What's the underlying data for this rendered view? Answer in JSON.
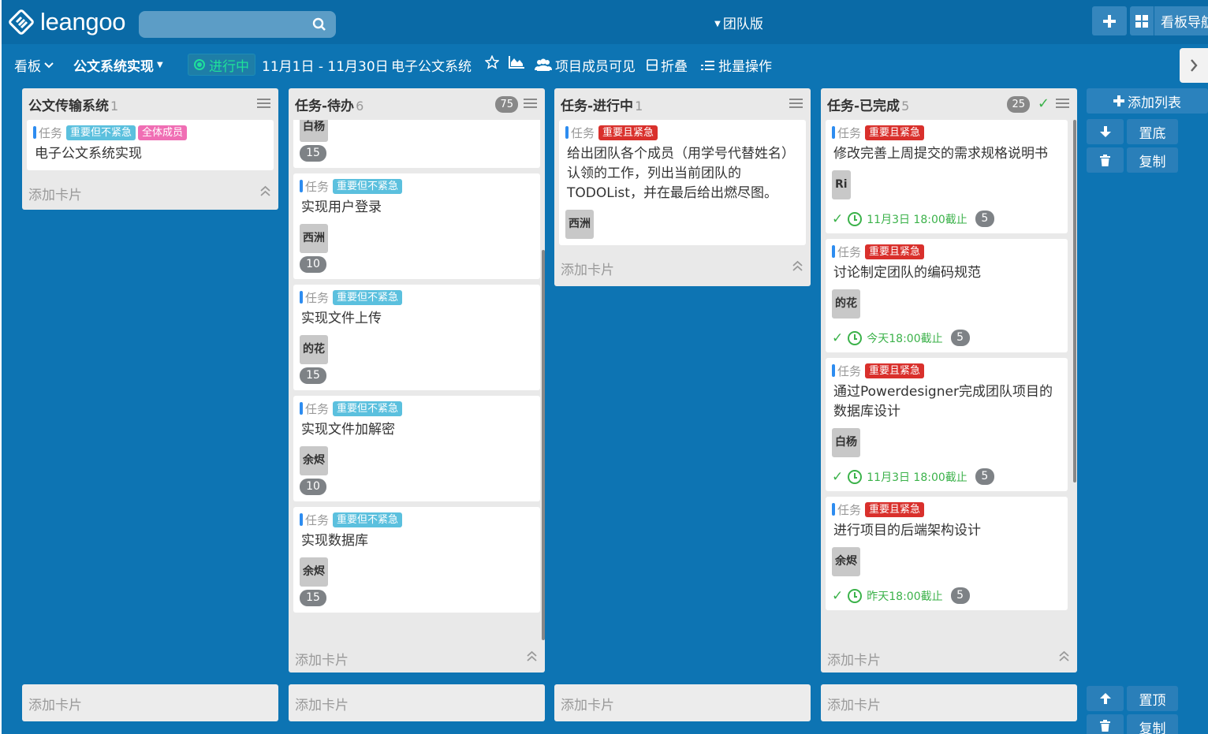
{
  "brand": "leangoo",
  "topbar": {
    "edition": "团队版",
    "board_nav_label": "看板导航"
  },
  "subbar": {
    "board_menu": "看板",
    "project_name": "公文系统实现",
    "status": "进行中",
    "date_range": "11月1日 - 11月30日",
    "project_label": "电子公文系统",
    "members_visible": "项目成员可见",
    "fold": "折叠",
    "batch": "批量操作"
  },
  "lists": [
    {
      "title": "公文传输系统",
      "count": "1",
      "cards": [
        {
          "type": "任务",
          "labels": [
            {
              "text": "重要但不紧急",
              "color": "#5bc0de"
            },
            {
              "text": "全体成员",
              "color": "#f06eb4"
            }
          ],
          "title": "电子公文系统实现"
        }
      ],
      "add_card": "添加卡片"
    },
    {
      "title": "任务-待办",
      "count": "6",
      "badge": "75",
      "cards": [
        {
          "assignee": "白杨",
          "points": "15"
        },
        {
          "type": "任务",
          "labels": [
            {
              "text": "重要但不紧急",
              "color": "#5bc0de"
            }
          ],
          "title": "实现用户登录",
          "assignee": "西洲",
          "points": "10"
        },
        {
          "type": "任务",
          "labels": [
            {
              "text": "重要但不紧急",
              "color": "#5bc0de"
            }
          ],
          "title": "实现文件上传",
          "assignee": "的花",
          "points": "15"
        },
        {
          "type": "任务",
          "labels": [
            {
              "text": "重要但不紧急",
              "color": "#5bc0de"
            }
          ],
          "title": "实现文件加解密",
          "assignee": "余烬",
          "points": "10"
        },
        {
          "type": "任务",
          "labels": [
            {
              "text": "重要但不紧急",
              "color": "#5bc0de"
            }
          ],
          "title": "实现数据库",
          "assignee": "余烬",
          "points": "15"
        }
      ],
      "add_card": "添加卡片"
    },
    {
      "title": "任务-进行中",
      "count": "1",
      "cards": [
        {
          "type": "任务",
          "labels": [
            {
              "text": "重要且紧急",
              "color": "#d9302c"
            }
          ],
          "title": "给出团队各个成员（用学号代替姓名）认领的工作，列出当前团队的TODOList，并在最后给出燃尽图。",
          "assignee": "西洲"
        }
      ],
      "add_card": "添加卡片"
    },
    {
      "title": "任务-已完成",
      "count": "5",
      "badge": "25",
      "cards": [
        {
          "type": "任务",
          "labels": [
            {
              "text": "重要且紧急",
              "color": "#d9302c"
            }
          ],
          "title": "修改完善上周提交的需求规格说明书",
          "assignee": "Ri",
          "due": "11月3日 18:00截止",
          "due_count": "5"
        },
        {
          "type": "任务",
          "labels": [
            {
              "text": "重要且紧急",
              "color": "#d9302c"
            }
          ],
          "title": "讨论制定团队的编码规范",
          "assignee": "的花",
          "due": "今天18:00截止",
          "due_count": "5"
        },
        {
          "type": "任务",
          "labels": [
            {
              "text": "重要且紧急",
              "color": "#d9302c"
            }
          ],
          "title": "通过Powerdesigner完成团队项目的数据库设计",
          "assignee": "白杨",
          "due": "11月3日 18:00截止",
          "due_count": "5"
        },
        {
          "type": "任务",
          "labels": [
            {
              "text": "重要且紧急",
              "color": "#d9302c"
            }
          ],
          "title": "进行项目的后端架构设计",
          "assignee": "余烬",
          "due": "昨天18:00截止",
          "due_count": "5"
        }
      ],
      "add_card": "添加卡片"
    }
  ],
  "bottom_add": [
    "添加卡片",
    "添加卡片",
    "添加卡片",
    "添加卡片"
  ],
  "side": {
    "add_list": "添加列表",
    "to_bottom": "置底",
    "copy": "复制",
    "to_top": "置顶",
    "copy2": "复制"
  },
  "colors": {
    "board_bg": "#0d74b3",
    "topbar_bg": "#0a6aa6",
    "status_green": "#1fe09a",
    "done_green": "#3bb24a",
    "important": "#5bc0de",
    "urgent": "#d9302c"
  }
}
